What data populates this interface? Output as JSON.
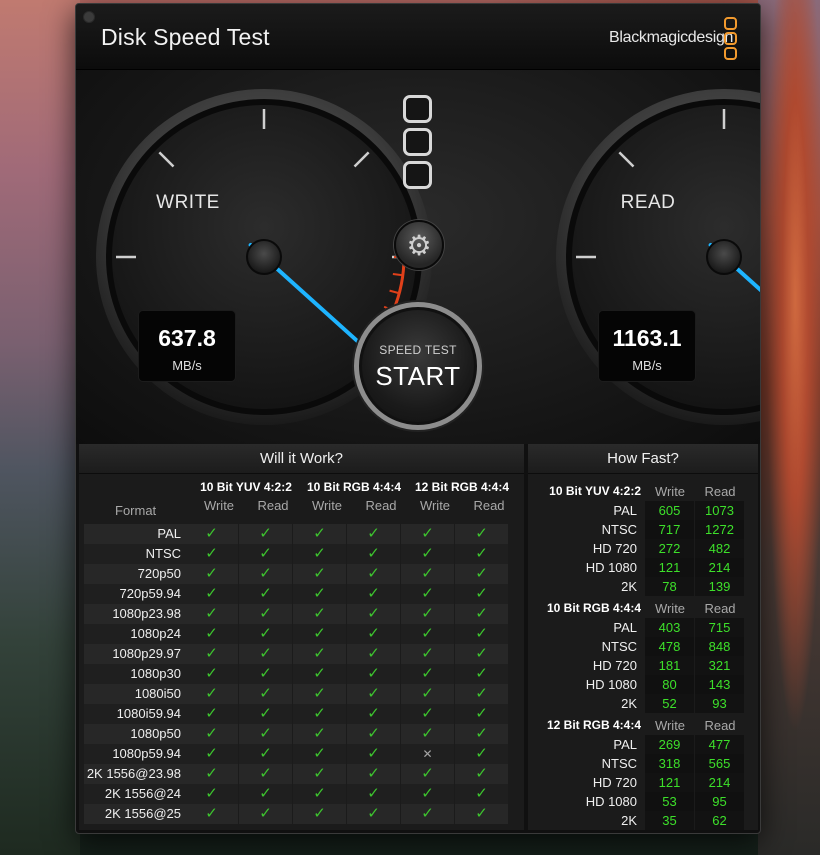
{
  "window": {
    "title": "Disk Speed Test",
    "brand": "Blackmagicdesign"
  },
  "colors": {
    "accent_needle": "#1eb4ff",
    "redline": "#e0401a",
    "check_green": "#3dc42e",
    "value_green": "#3de02a",
    "logo_orange": "#f29a2e"
  },
  "gauges": {
    "write": {
      "label": "WRITE",
      "value": "637.8",
      "unit": "MB/s"
    },
    "read": {
      "label": "READ",
      "value": "1163.1",
      "unit": "MB/s"
    }
  },
  "controls": {
    "settings_icon": "gear-icon",
    "start_small": "SPEED TEST",
    "start_big": "START"
  },
  "will_it_work": {
    "title": "Will it Work?",
    "format_label": "Format",
    "sections": [
      "10 Bit YUV 4:2:2",
      "10 Bit RGB 4:4:4",
      "12 Bit RGB 4:4:4"
    ],
    "col_write": "Write",
    "col_read": "Read",
    "rows": [
      {
        "format": "PAL",
        "cells": [
          "✓",
          "✓",
          "✓",
          "✓",
          "✓",
          "✓"
        ]
      },
      {
        "format": "NTSC",
        "cells": [
          "✓",
          "✓",
          "✓",
          "✓",
          "✓",
          "✓"
        ]
      },
      {
        "format": "720p50",
        "cells": [
          "✓",
          "✓",
          "✓",
          "✓",
          "✓",
          "✓"
        ]
      },
      {
        "format": "720p59.94",
        "cells": [
          "✓",
          "✓",
          "✓",
          "✓",
          "✓",
          "✓"
        ]
      },
      {
        "format": "1080p23.98",
        "cells": [
          "✓",
          "✓",
          "✓",
          "✓",
          "✓",
          "✓"
        ]
      },
      {
        "format": "1080p24",
        "cells": [
          "✓",
          "✓",
          "✓",
          "✓",
          "✓",
          "✓"
        ]
      },
      {
        "format": "1080p29.97",
        "cells": [
          "✓",
          "✓",
          "✓",
          "✓",
          "✓",
          "✓"
        ]
      },
      {
        "format": "1080p30",
        "cells": [
          "✓",
          "✓",
          "✓",
          "✓",
          "✓",
          "✓"
        ]
      },
      {
        "format": "1080i50",
        "cells": [
          "✓",
          "✓",
          "✓",
          "✓",
          "✓",
          "✓"
        ]
      },
      {
        "format": "1080i59.94",
        "cells": [
          "✓",
          "✓",
          "✓",
          "✓",
          "✓",
          "✓"
        ]
      },
      {
        "format": "1080p50",
        "cells": [
          "✓",
          "✓",
          "✓",
          "✓",
          "✓",
          "✓"
        ]
      },
      {
        "format": "1080p59.94",
        "cells": [
          "✓",
          "✓",
          "✓",
          "✓",
          "✕",
          "✓"
        ]
      },
      {
        "format": "2K 1556@23.98",
        "cells": [
          "✓",
          "✓",
          "✓",
          "✓",
          "✓",
          "✓"
        ]
      },
      {
        "format": "2K 1556@24",
        "cells": [
          "✓",
          "✓",
          "✓",
          "✓",
          "✓",
          "✓"
        ]
      },
      {
        "format": "2K 1556@25",
        "cells": [
          "✓",
          "✓",
          "✓",
          "✓",
          "✓",
          "✓"
        ]
      }
    ]
  },
  "how_fast": {
    "title": "How Fast?",
    "col_write": "Write",
    "col_read": "Read",
    "sections": [
      {
        "name": "10 Bit YUV 4:2:2",
        "rows": [
          {
            "format": "PAL",
            "write": "605",
            "read": "1073"
          },
          {
            "format": "NTSC",
            "write": "717",
            "read": "1272"
          },
          {
            "format": "HD 720",
            "write": "272",
            "read": "482"
          },
          {
            "format": "HD 1080",
            "write": "121",
            "read": "214"
          },
          {
            "format": "2K",
            "write": "78",
            "read": "139"
          }
        ]
      },
      {
        "name": "10 Bit RGB 4:4:4",
        "rows": [
          {
            "format": "PAL",
            "write": "403",
            "read": "715"
          },
          {
            "format": "NTSC",
            "write": "478",
            "read": "848"
          },
          {
            "format": "HD 720",
            "write": "181",
            "read": "321"
          },
          {
            "format": "HD 1080",
            "write": "80",
            "read": "143"
          },
          {
            "format": "2K",
            "write": "52",
            "read": "93"
          }
        ]
      },
      {
        "name": "12 Bit RGB 4:4:4",
        "rows": [
          {
            "format": "PAL",
            "write": "269",
            "read": "477"
          },
          {
            "format": "NTSC",
            "write": "318",
            "read": "565"
          },
          {
            "format": "HD 720",
            "write": "121",
            "read": "214"
          },
          {
            "format": "HD 1080",
            "write": "53",
            "read": "95"
          },
          {
            "format": "2K",
            "write": "35",
            "read": "62"
          }
        ]
      }
    ]
  }
}
